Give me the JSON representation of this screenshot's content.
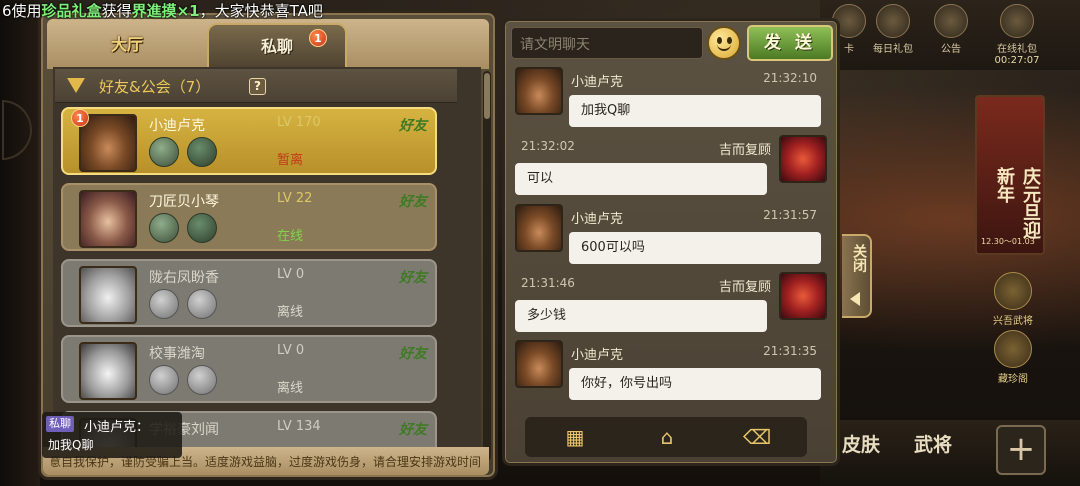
{
  "notice": {
    "prefix": "6使用",
    "item": "珍品礼盒",
    "mid": "获得",
    "reward": "界進摸×1",
    "suffix": "，大家快恭喜TA吧"
  },
  "tabs": {
    "hall": "大厅",
    "private": "私聊",
    "private_badge": "1"
  },
  "group": {
    "title": "好友&公会（7）",
    "help": "?"
  },
  "friends": [
    {
      "name": "小迪卢克",
      "level": "LV 170",
      "tag": "好友",
      "status": "暂离",
      "badge": "1"
    },
    {
      "name": "刀匠贝小琴",
      "level": "LV 22",
      "tag": "好友",
      "status": "在线"
    },
    {
      "name": "陇右凤盼香",
      "level": "LV 0",
      "tag": "好友",
      "status": "离线"
    },
    {
      "name": "校事潍淘",
      "level": "LV 0",
      "tag": "好友",
      "status": "离线"
    },
    {
      "name": "学裕豪刘闻",
      "level": "LV 134",
      "tag": "好友"
    }
  ],
  "tip": "抵制不良游戏，拒绝盗版游戏。注意自我保护，谨防受骗上当。适度游戏益脑，过度游戏伤身，请合理安排游戏时间",
  "preview": {
    "tag": "私聊",
    "name": "小迪卢克：",
    "message": "加我Q聊"
  },
  "chat": {
    "input_placeholder": "请文明聊天",
    "send_label": "发 送",
    "messages": [
      {
        "dir": "in",
        "name": "小迪卢克",
        "time": "21:32:10",
        "text": "加我Q聊"
      },
      {
        "dir": "out",
        "name": "吉而复顾",
        "time": "21:32:02",
        "text": "可以"
      },
      {
        "dir": "in",
        "name": "小迪卢克",
        "time": "21:31:57",
        "text": "600可以吗"
      },
      {
        "dir": "out",
        "name": "吉而复顾",
        "time": "21:31:46",
        "text": "多少钱"
      },
      {
        "dir": "in",
        "name": "小迪卢克",
        "time": "21:31:35",
        "text": "你好，你号出吗"
      }
    ],
    "tools": [
      "名片",
      "举报",
      "删除"
    ],
    "close_label": "关闭"
  },
  "background": {
    "top_items": [
      "卡",
      "每日礼包",
      "公告",
      "在线礼包"
    ],
    "online_timer": "00:27:07",
    "poster_title": "庆元旦迎新年",
    "poster_dates": "12.30～01.03",
    "side_items": [
      "兴吾武将",
      "藏珍阁"
    ],
    "bottom_items": [
      "皮肤",
      "武将"
    ]
  }
}
